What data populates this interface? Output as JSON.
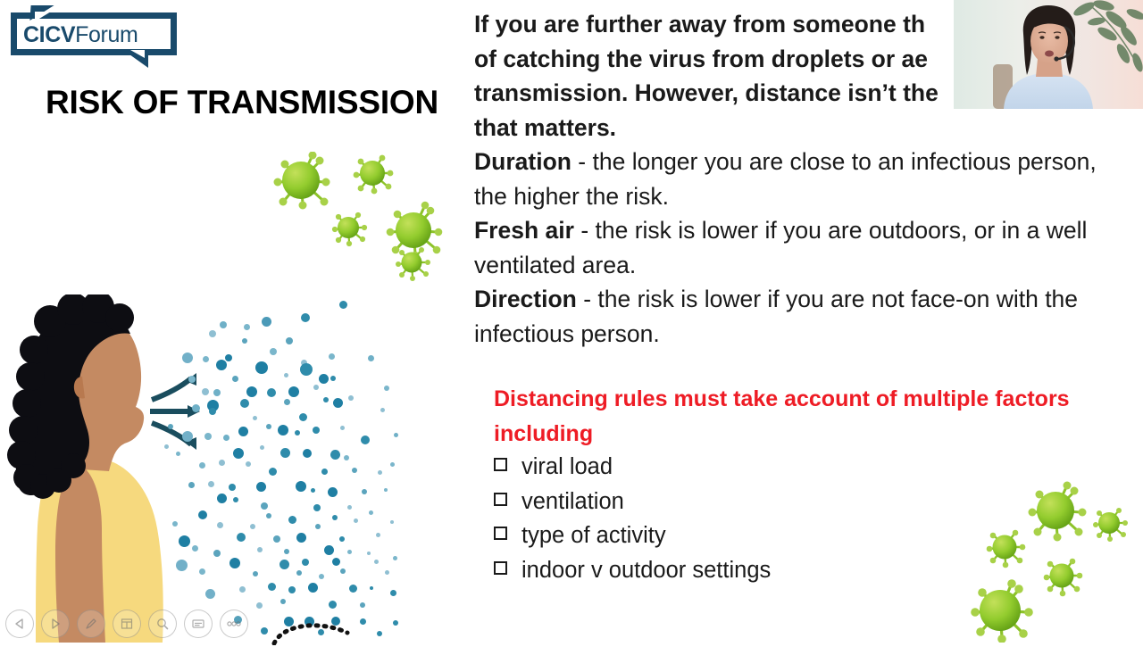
{
  "slide": {
    "logo": {
      "bold_part": "CICV",
      "light_part": "Forum",
      "color": "#194a6b"
    },
    "title": "RISK OF TRANSMISSION",
    "intro_paragraph": "If you are further away from someone th… of catching the virus from droplets or ae… transmission. However, distance isn’t th… that matters.",
    "intro_lines": [
      "If you are further away from someone th",
      "of catching the virus from droplets or ae",
      "transmission. However, distance isn’t the",
      "that matters."
    ],
    "factors": [
      {
        "term": "Duration",
        "dash": " - ",
        "text": "the longer you are close to an infectious person, the higher the risk."
      },
      {
        "term": "Fresh air",
        "dash": " - ",
        "text": "the risk is lower if you are outdoors, or in a well ventilated area."
      },
      {
        "term": "Direction",
        "dash": " - ",
        "text": "the risk is lower if you are not face-on with the infectious person."
      }
    ],
    "red_heading": "Distancing rules must take account of multiple factors including",
    "red_color": "#ee1c25",
    "checklist": [
      "viral load",
      "ventilation",
      "type of activity",
      "indoor v outdoor settings"
    ],
    "illustration": {
      "person_description": "woman in profile exhaling",
      "hair_color": "#0d0d12",
      "skin_color": "#c48a62",
      "top_color": "#f6d97e",
      "droplet_colors": [
        "#1f7fa3",
        "#2f8cab",
        "#5ba4bd",
        "#8fbfd2",
        "#17698c"
      ],
      "arrow_color": "#1a4d5e",
      "virus_color": "#7ec327"
    }
  },
  "video_overlay": {
    "present": true,
    "description": "webcam feed of presenter wearing a headset"
  },
  "toolbar": {
    "buttons": [
      {
        "name": "previous-slide",
        "label": "Previous slide",
        "icon": "triangle-left-icon"
      },
      {
        "name": "next-slide",
        "label": "Next slide",
        "icon": "triangle-right-icon"
      },
      {
        "name": "pen-tools",
        "label": "Pen and laser pointer tools",
        "icon": "pen-icon"
      },
      {
        "name": "see-all-slides",
        "label": "See all slides",
        "icon": "grid-icon"
      },
      {
        "name": "zoom-into-slide",
        "label": "Zoom into the slide",
        "icon": "magnifier-icon"
      },
      {
        "name": "toggle-subtitles",
        "label": "Toggle subtitles",
        "icon": "subtitles-icon"
      },
      {
        "name": "more-options",
        "label": "More slide show options",
        "icon": "ellipsis-icon"
      }
    ]
  }
}
